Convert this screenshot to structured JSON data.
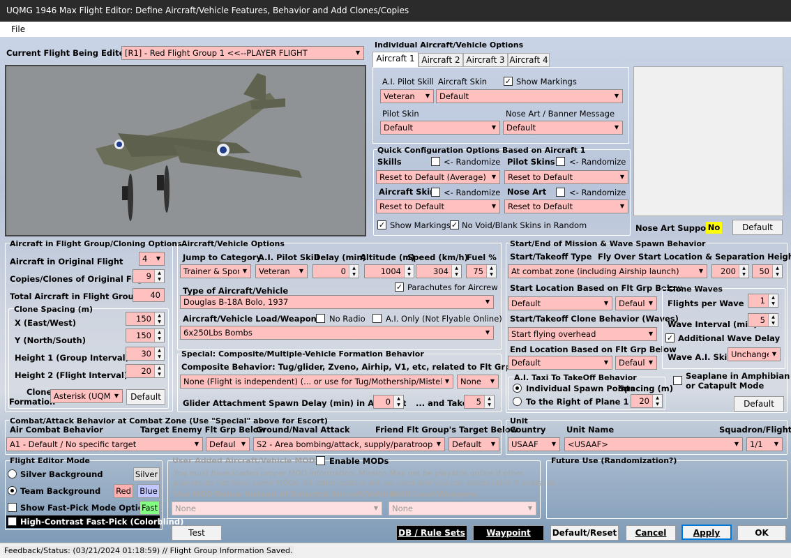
{
  "window": {
    "title": "UQMG 1946 Max Flight Editor:  Define Aircraft/Vehicle Features, Behavior and Add Clones/Copies"
  },
  "menu": {
    "file": "File"
  },
  "current": {
    "label": "Current Flight Being Edited:",
    "value": "[R1] -  Red Flight Group  1     <<--PLAYER FLIGHT"
  },
  "individual": {
    "title": "Individual Aircraft/Vehicle Options",
    "tabs": [
      "Aircraft 1",
      "Aircraft 2",
      "Aircraft 3",
      "Aircraft 4"
    ],
    "pilot_skill_label": "A.I. Pilot Skill",
    "pilot_skill": "Veteran",
    "skin_label": "Aircraft Skin",
    "skin": "Default",
    "show_markings": "Show Markings",
    "pilot_skin_label": "Pilot Skin",
    "pilot_skin": "Default",
    "nose_art_label": "Nose Art / Banner Message",
    "nose_art": "Default",
    "nose_art_support": "Nose Art Support:",
    "nose_art_support_value": "No",
    "default_btn": "Default"
  },
  "quick": {
    "title": "Quick Configuration Options Based on Aircraft 1",
    "skills": "Skills",
    "randomize": "<- Randomize",
    "pilot_skins": "Pilot Skins",
    "skills_value": "Reset to Default (Average)",
    "pilot_skins_value": "Reset to Default",
    "aircraft_skins": "Aircraft Skins",
    "nose_art": "Nose Art",
    "aircraft_skins_value": "Reset to Default",
    "nose_art_value": "Reset to Default",
    "show_markings": "Show Markings",
    "no_void": "No Void/Blank Skins in Random"
  },
  "clone": {
    "title": "Aircraft in Flight Group/Cloning Options",
    "orig_label": "Aircraft in Original Flight",
    "orig": "4",
    "copies_label": "Copies/Clones of Original Flight",
    "copies": "9",
    "total_label": "Total Aircraft in Flight Group",
    "total": "40",
    "spacing_title": "Clone Spacing (m)",
    "x_label": "X (East/West)",
    "x": "150",
    "y_label": "Y (North/South)",
    "y": "150",
    "h1_label": "Height 1 (Group Interval)",
    "h1": "30",
    "h2_label": "Height 2 (Flight Interval)",
    "h2": "20",
    "formation_label1": "Clone",
    "formation_label2": "Formation",
    "formation": "Asterisk (UQM",
    "default_btn": "Default"
  },
  "acv": {
    "title": "Aircraft/Vehicle Options",
    "jump_label": "Jump to Category",
    "jump": "Trainer & Spor",
    "skill_label": "A.I. Pilot Skill",
    "skill": "Veteran",
    "delay_label": "Delay (min)",
    "delay": "0",
    "alt_label": "Altitude (m)",
    "alt": "1004",
    "speed_label": "Speed (km/h)",
    "speed": "304",
    "fuel_label": "Fuel %",
    "fuel": "75",
    "type_label": "Type of Aircraft/Vehicle",
    "parachutes": "Parachutes for Aircrew",
    "type": "Douglas B-18A Bolo, 1937",
    "load_label": "Aircraft/Vehicle Load/Weapons",
    "no_radio": "No Radio",
    "ai_only": "A.I. Only (Not Flyable Online)",
    "load": "6x250Lbs Bombs"
  },
  "special": {
    "title": "Special: Composite/Multiple-Vehicle Formation Behavior",
    "composite_label": "Composite Behavior: Tug/glider, Zveno, Airhip, V1, etc, related to Flt Grp Below",
    "composite": "None (Flight is independent) (... or use for Tug/Mothership/Mistel Bo",
    "composite2": "None",
    "glider_label": "Glider Attachment Spawn Delay (min) in Air Start",
    "glider_delay": "0",
    "takeoff_label": "... and Takeoff",
    "takeoff": "5"
  },
  "startend": {
    "title": "Start/End of Mission & Wave Spawn Behavior",
    "start_type_label": "Start/Takeoff Type",
    "fly_over_label": "Fly Over Start Location & Separation Heights (m)",
    "start_type": "At combat zone (including Airship launch)",
    "h_a": "200",
    "h_b": "50",
    "start_loc_label": "Start Location Based on Flt Grp Below",
    "start_loc": "Default",
    "start_loc2": "Defaul",
    "clone_beh_label": "Start/Takeoff Clone Behavior (Waves)",
    "clone_beh": "Start flying overhead",
    "end_loc_label": "End Location Based on Flt Grp Below",
    "end_loc": "Default",
    "end_loc2": "Defaul",
    "taxi_title": "A.I. Taxi To TakeOff Behavior",
    "individual_spawn": "Individual Spawn Points",
    "spacing": "Spacing (m)",
    "right_of": "To the Right of Plane 1 ->",
    "right_val": "20",
    "waves_title": "Clone Waves",
    "flights_per_wave_label": "Flights per Wave",
    "flights_per_wave": "1",
    "wave_interval_label": "Wave Interval (min)",
    "wave_interval": "5",
    "additional_delay": "Additional Wave Delay",
    "wave_skills_label": "Wave A.I. Skills",
    "wave_skills": "Unchange",
    "seaplane1": "Seaplane in Amphibian",
    "seaplane2": "or Catapult Mode",
    "default_btn": "Default"
  },
  "combat": {
    "title": "Combat/Attack Behavior at Combat Zone (Use \"Special\" above for Escort)",
    "air_label": "Air Combat Behavior",
    "target_label": "Target Enemy Flt Grp Below",
    "ground_label": "Ground/Naval Attack",
    "friend_label": "Friend Flt Group's Target Below",
    "air": "A1 - Default / No specific target",
    "target": "Defaul",
    "ground": "S2 - Area bombing/attack, supply/paratrooper",
    "friend": "Default"
  },
  "unit": {
    "title": "Unit",
    "country_label": "Country",
    "name_label": "Unit Name",
    "squadron_label": "Squadron/Flight",
    "country": "USAAF",
    "name": "<USAAF>",
    "squadron": "1/1"
  },
  "mode": {
    "title": "Flight Editor Mode",
    "silver_bg": "Silver Background",
    "silver": "Silver",
    "team_bg": "Team Background",
    "red": "Red",
    "blue": "Blue",
    "fast_pick": "Show Fast-Pick Mode Options",
    "fast": "Fast",
    "high_contrast": "High-Contrast Fast-Pick (Colorblind)"
  },
  "mods": {
    "title": "User Added Aircraft/Vehicle MODs",
    "enable": "Enable MODs",
    "desc1": "You must have loaded proper MOD information. Mission May not be playable online if other",
    "desc2": "players do not have same MODs.  All other options will be used and you can select skins if available.",
    "use_label": "Use MOD Below Instead of Selected Aircraft/Vehicle",
    "load_label": "MOD Load/Weapons",
    "mod": "None",
    "mod_load": "None"
  },
  "future": {
    "title": "Future Use (Randomization?)"
  },
  "buttons": {
    "test": "Test",
    "db": "DB / Rule Sets",
    "waypoint": "Waypoint Editor",
    "default_reset": "Default/Reset",
    "cancel": "Cancel",
    "apply": "Apply",
    "ok": "OK"
  },
  "status": {
    "text": "Feedback/Status:  (03/21/2024 01:18:59) // Flight Group Information Saved."
  }
}
